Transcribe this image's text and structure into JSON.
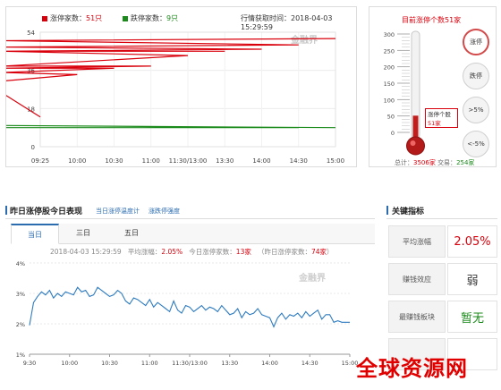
{
  "top_chart": {
    "legend_up": "涨停家数：",
    "legend_up_count": "51只",
    "legend_down": "跌停家数：",
    "legend_down_count": "9只",
    "time_label": "行情获取时间：2018-04-03 15:29:59",
    "watermark": "金融界",
    "y_ticks": [
      "54",
      "36",
      "18",
      "0"
    ],
    "x_ticks": [
      "09:25",
      "10:00",
      "10:30",
      "11:00",
      "11:30/13:00",
      "13:30",
      "14:00",
      "14:30",
      "15:00"
    ],
    "colors": {
      "up": "#d9000c",
      "down": "#1a8a1a"
    },
    "chart_data": {
      "type": "line",
      "y_range": [
        0,
        54
      ],
      "series": [
        {
          "name": "涨停家数",
          "x": [
            "09:25",
            "09:35",
            "09:45",
            "10:00",
            "10:15",
            "10:30",
            "10:45",
            "11:00",
            "11:15",
            "11:30/13:00",
            "13:15",
            "13:30",
            "13:45",
            "14:00",
            "14:15",
            "14:30",
            "14:45",
            "15:00"
          ],
          "values": [
            14,
            25,
            31,
            34,
            35,
            37,
            37,
            38,
            38,
            43,
            45,
            45,
            45,
            46,
            47,
            48,
            50,
            51
          ]
        },
        {
          "name": "跌停家数",
          "x": [
            "09:25",
            "09:35",
            "09:45",
            "10:00",
            "10:15",
            "10:30",
            "10:45",
            "11:00",
            "11:15",
            "11:30/13:00",
            "13:15",
            "13:30",
            "13:45",
            "14:00",
            "14:15",
            "14:30",
            "14:45",
            "15:00"
          ],
          "values": [
            9,
            9,
            9,
            9,
            9,
            9,
            9,
            9,
            9,
            9,
            9,
            9,
            9,
            9,
            9,
            9,
            10,
            9
          ]
        }
      ]
    }
  },
  "thermo": {
    "title": "目前涨停个数51家",
    "scale": [
      "300",
      "250",
      "200",
      "150",
      "100",
      "50",
      "0"
    ],
    "tooltip_line1": "涨停个股",
    "tooltip_line2": "51家",
    "level_value": 51,
    "level_max": 300,
    "total_label": "总计：",
    "total_value": "3506家",
    "trading_label": "交易：",
    "trading_value": "254家",
    "buttons": [
      "涨停",
      "跌停",
      ">5%",
      "<-5%"
    ]
  },
  "bottom": {
    "title": "昨日涨停股今日表现",
    "link1": "当日涨停温度计",
    "link2": "涨跌停强度",
    "tabs": [
      "当日",
      "三日",
      "五日"
    ],
    "info_time": "2018-04-03 15:29:59",
    "info_avg_label": "平均涨幅：",
    "info_avg_value": "2.05%",
    "info_today_label": "今日涨停家数：",
    "info_today_value": "13家",
    "info_yday_label": "（昨日涨停家数：",
    "info_yday_value": "74家",
    "info_yday_close": "）",
    "watermark": "金融界",
    "y_ticks": [
      "4%",
      "3%",
      "2%",
      "1%"
    ],
    "x_ticks": [
      "9:30",
      "10:00",
      "10:30",
      "11:00",
      "11:30/13:00",
      "13:30",
      "14:00",
      "14:30",
      "15:00"
    ],
    "chart_data": {
      "type": "line",
      "y_range": [
        1,
        4
      ],
      "series": [
        {
          "x_index": [
            0,
            0.1,
            0.2,
            0.3,
            0.4,
            0.5,
            0.6,
            0.7,
            0.8,
            0.9,
            1.0,
            1.1,
            1.2,
            1.3,
            1.4,
            1.5,
            1.6,
            1.7,
            1.8,
            1.9,
            2.0,
            2.1,
            2.2,
            2.3,
            2.4,
            2.5,
            2.6,
            2.7,
            2.8,
            2.9,
            3.0,
            3.1,
            3.2,
            3.3,
            3.4,
            3.5,
            3.6,
            3.7,
            3.8,
            3.9,
            4.0,
            4.1,
            4.2,
            4.3,
            4.4,
            4.5,
            4.6,
            4.7,
            4.8,
            4.9,
            5.0,
            5.1,
            5.2,
            5.3,
            5.4,
            5.5,
            5.6,
            5.7,
            5.8,
            5.9,
            6.0,
            6.1,
            6.2,
            6.3,
            6.4,
            6.5,
            6.6,
            6.7,
            6.8,
            6.9,
            7.0,
            7.1,
            7.2,
            7.3,
            7.4,
            7.5,
            7.6,
            7.7,
            7.8,
            7.9,
            8.0
          ],
          "values": [
            1.95,
            2.7,
            2.9,
            3.05,
            2.95,
            3.1,
            2.85,
            3.0,
            2.9,
            3.05,
            3.0,
            2.95,
            3.2,
            3.05,
            3.1,
            2.9,
            2.95,
            3.2,
            3.1,
            3.0,
            2.9,
            2.95,
            3.1,
            3.0,
            2.75,
            2.65,
            2.85,
            2.8,
            2.7,
            2.6,
            2.8,
            2.55,
            2.7,
            2.6,
            2.5,
            2.4,
            2.75,
            2.45,
            2.35,
            2.6,
            2.55,
            2.4,
            2.5,
            2.6,
            2.45,
            2.55,
            2.5,
            2.4,
            2.6,
            2.45,
            2.3,
            2.35,
            2.5,
            2.2,
            2.4,
            2.3,
            2.35,
            2.5,
            2.3,
            2.25,
            2.2,
            1.9,
            2.2,
            2.35,
            2.15,
            2.3,
            2.25,
            2.35,
            2.2,
            2.4,
            2.25,
            2.35,
            2.45,
            2.15,
            2.3,
            2.3,
            2.05,
            2.1,
            2.05,
            2.05,
            2.05
          ]
        }
      ]
    }
  },
  "kpi": {
    "title": "关键指标",
    "rows": [
      {
        "label": "平均涨幅",
        "value": "2.05%"
      },
      {
        "label": "赚钱效应",
        "value": "弱"
      },
      {
        "label": "最赚钱板块",
        "value": "暂无"
      }
    ]
  },
  "footer_watermark": "全球资源网"
}
